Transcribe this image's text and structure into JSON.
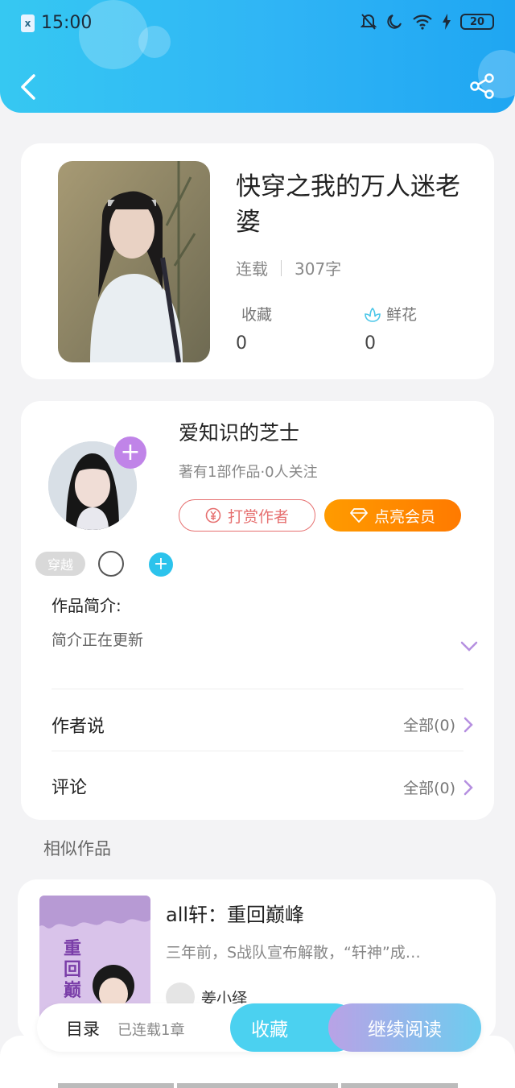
{
  "status_bar": {
    "time": "15:00",
    "battery": "20",
    "sim_label": "x"
  },
  "header": {
    "back_icon": "back-arrow-icon",
    "share_icon": "share-icon"
  },
  "book": {
    "title": "快穿之我的万人迷老婆",
    "status": "连载",
    "word_count": "307字",
    "collect_label": "收藏",
    "collect_count": "0",
    "flower_label": "鲜花",
    "flower_count": "0"
  },
  "author": {
    "name": "爱知识的芝士",
    "meta": "著有1部作品·0人关注",
    "tip_label": "打赏作者",
    "vip_label": "点亮会员",
    "follow_symbol": "+"
  },
  "tags": {
    "items": [
      "穿越"
    ],
    "add_symbol": "+"
  },
  "intro": {
    "title": "作品简介:",
    "text": "简介正在更新"
  },
  "author_says": {
    "label": "作者说",
    "right": "全部(0)"
  },
  "comments": {
    "label": "评论",
    "right": "全部(0)"
  },
  "similar": {
    "section_title": "相似作品",
    "items": [
      {
        "title": "all轩：重回巅峰",
        "desc": "三年前，S战队宣布解散，“轩神”成…",
        "author": "姜小绎",
        "cover_text": "重回巅"
      }
    ]
  },
  "bottom": {
    "toc_label": "目录",
    "toc_count": "已连载1章",
    "collect_label": "收藏",
    "read_label": "继续阅读"
  },
  "colors": {
    "header": "#2fb4f5",
    "accent_purple": "#c084e8",
    "vip_orange": "#ff8a00",
    "tip_red": "#e66f6f",
    "cyan": "#4bd1f0"
  }
}
